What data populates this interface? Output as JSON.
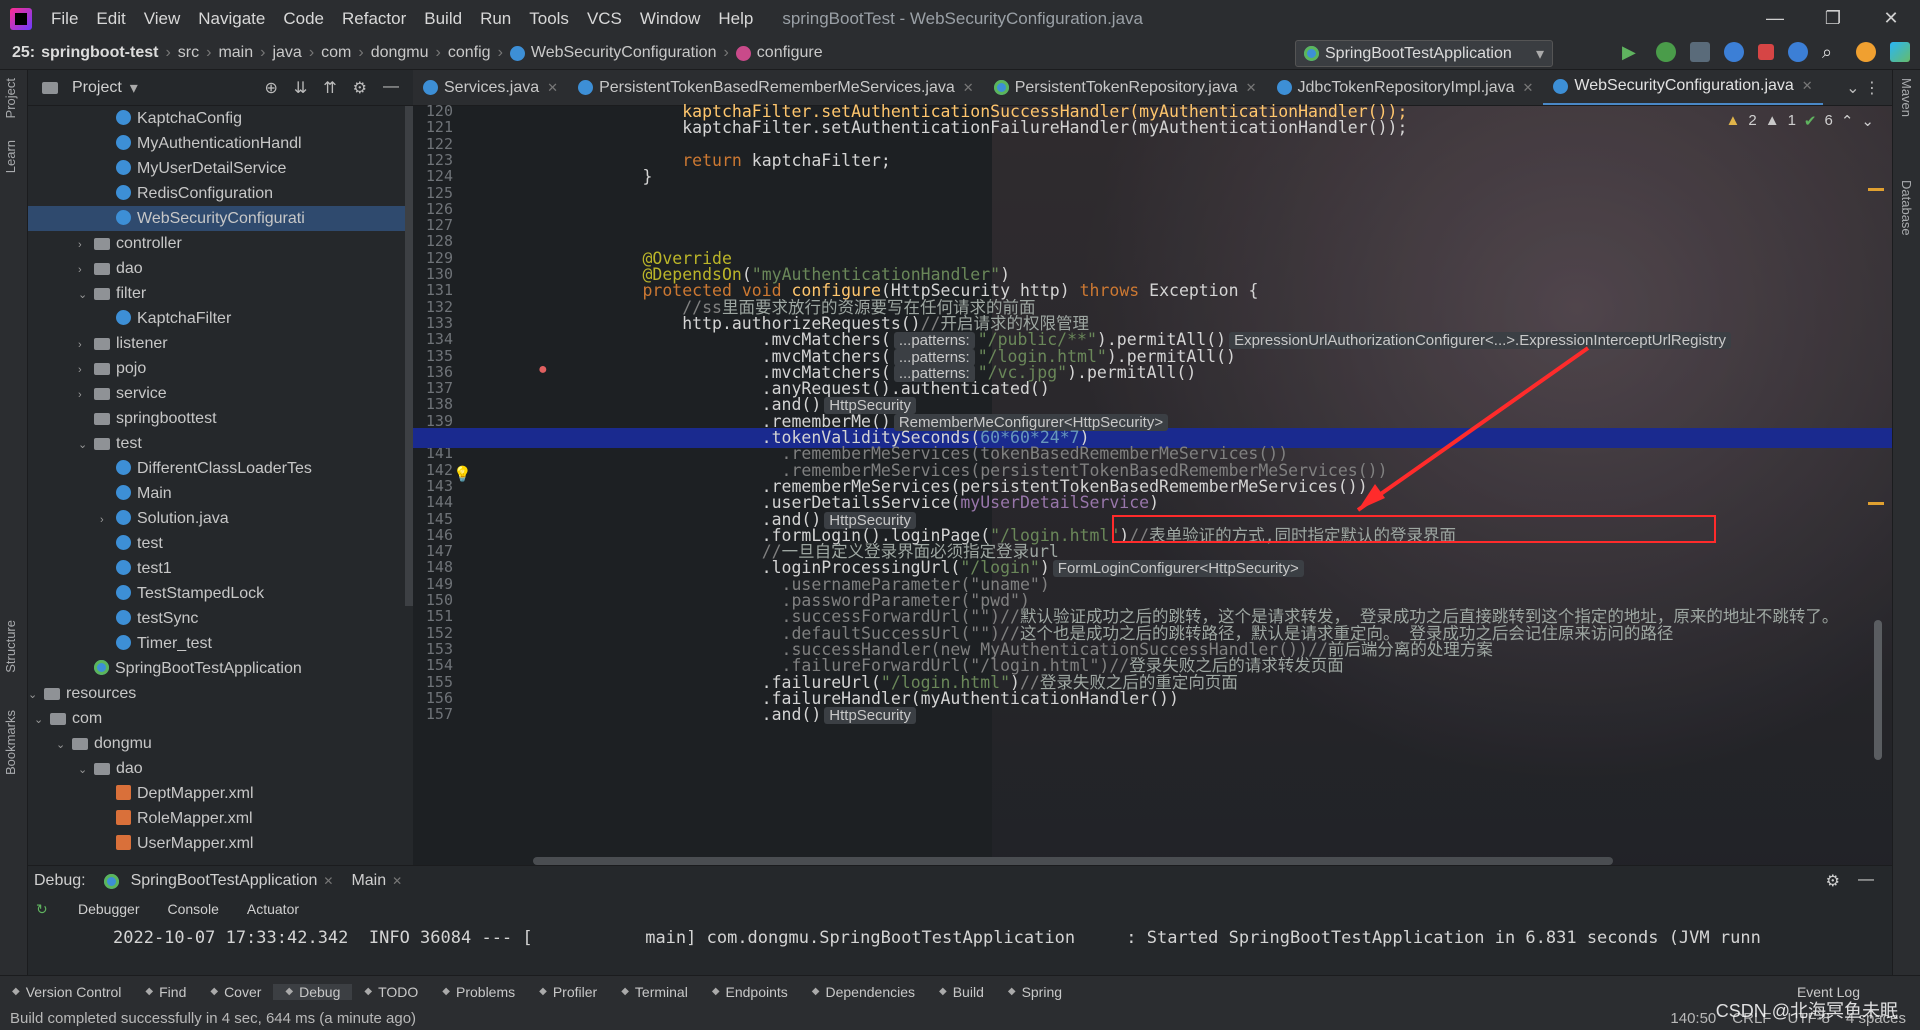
{
  "menubar": {
    "items": [
      "File",
      "Edit",
      "View",
      "Navigate",
      "Code",
      "Refactor",
      "Build",
      "Run",
      "Tools",
      "VCS",
      "Window",
      "Help"
    ],
    "title": "springBootTest - WebSecurityConfiguration.java"
  },
  "nav": {
    "prefix": "25:",
    "project": "springboot-test",
    "crumbs": [
      "src",
      "main",
      "java",
      "com",
      "dongmu",
      "config",
      "WebSecurityConfiguration",
      "configure"
    ],
    "run_config": "SpringBootTestApplication"
  },
  "project_panel": {
    "title": "Project",
    "items": [
      {
        "label": "KaptchaConfig",
        "indent": 6,
        "icon": "c",
        "arrow": ""
      },
      {
        "label": "MyAuthenticationHandl",
        "indent": 6,
        "icon": "c",
        "arrow": ""
      },
      {
        "label": "MyUserDetailService",
        "indent": 6,
        "icon": "c",
        "arrow": ""
      },
      {
        "label": "RedisConfiguration",
        "indent": 6,
        "icon": "c",
        "arrow": ""
      },
      {
        "label": "WebSecurityConfigurati",
        "indent": 6,
        "icon": "c",
        "arrow": "",
        "selected": true
      },
      {
        "label": "controller",
        "indent": 5,
        "icon": "folder",
        "arrow": "›"
      },
      {
        "label": "dao",
        "indent": 5,
        "icon": "folder",
        "arrow": "›"
      },
      {
        "label": "filter",
        "indent": 5,
        "icon": "folder",
        "arrow": "⌄"
      },
      {
        "label": "KaptchaFilter",
        "indent": 6,
        "icon": "c",
        "arrow": ""
      },
      {
        "label": "listener",
        "indent": 5,
        "icon": "folder",
        "arrow": "›"
      },
      {
        "label": "pojo",
        "indent": 5,
        "icon": "folder",
        "arrow": "›"
      },
      {
        "label": "service",
        "indent": 5,
        "icon": "folder",
        "arrow": "›"
      },
      {
        "label": "springboottest",
        "indent": 5,
        "icon": "folder",
        "arrow": ""
      },
      {
        "label": "test",
        "indent": 5,
        "icon": "folder",
        "arrow": "⌄"
      },
      {
        "label": "DifferentClassLoaderTes",
        "indent": 6,
        "icon": "c",
        "arrow": ""
      },
      {
        "label": "Main",
        "indent": 6,
        "icon": "c",
        "arrow": ""
      },
      {
        "label": "Solution.java",
        "indent": 6,
        "icon": "c",
        "arrow": "›"
      },
      {
        "label": "test",
        "indent": 6,
        "icon": "c",
        "arrow": ""
      },
      {
        "label": "test1",
        "indent": 6,
        "icon": "c",
        "arrow": ""
      },
      {
        "label": "TestStampedLock",
        "indent": 6,
        "icon": "c",
        "arrow": ""
      },
      {
        "label": "testSync",
        "indent": 6,
        "icon": "c",
        "arrow": ""
      },
      {
        "label": "Timer_test",
        "indent": 6,
        "icon": "c",
        "arrow": ""
      },
      {
        "label": "SpringBootTestApplication",
        "indent": 5,
        "icon": "sp",
        "arrow": ""
      },
      {
        "label": "resources",
        "indent": 2,
        "icon": "folder",
        "arrow": "⌄"
      },
      {
        "label": "com",
        "indent": 3,
        "icon": "folder",
        "arrow": "⌄"
      },
      {
        "label": "dongmu",
        "indent": 4,
        "icon": "folder",
        "arrow": "⌄"
      },
      {
        "label": "dao",
        "indent": 5,
        "icon": "folder",
        "arrow": "⌄"
      },
      {
        "label": "DeptMapper.xml",
        "indent": 6,
        "icon": "xml",
        "arrow": ""
      },
      {
        "label": "RoleMapper.xml",
        "indent": 6,
        "icon": "xml",
        "arrow": ""
      },
      {
        "label": "UserMapper.xml",
        "indent": 6,
        "icon": "xml",
        "arrow": ""
      }
    ]
  },
  "tabs": [
    {
      "label": "Services.java",
      "active": false
    },
    {
      "label": "PersistentTokenBasedRememberMeServices.java",
      "active": false
    },
    {
      "label": "PersistentTokenRepository.java",
      "active": false
    },
    {
      "label": "JdbcTokenRepositoryImpl.java",
      "active": false
    },
    {
      "label": "WebSecurityConfiguration.java",
      "active": true
    }
  ],
  "inspections": {
    "warnings": "2",
    "weak": "1",
    "ok": "6"
  },
  "lines": [
    {
      "n": "120",
      "h": "            <span class='m'>kaptchaFilter.setAuthenticationSuccessHandler(myAuthenticationHandler());</span>"
    },
    {
      "n": "121",
      "h": "            kaptchaFilter.setAuthenticationFailureHandler(myAuthenticationHandler());"
    },
    {
      "n": "122",
      "h": ""
    },
    {
      "n": "123",
      "h": "            <span class='k'>return</span> kaptchaFilter;"
    },
    {
      "n": "124",
      "h": "        }"
    },
    {
      "n": "125",
      "h": ""
    },
    {
      "n": "126",
      "h": ""
    },
    {
      "n": "127",
      "h": ""
    },
    {
      "n": "128",
      "h": ""
    },
    {
      "n": "129",
      "h": "        <span class='a'>@Override</span>"
    },
    {
      "n": "130",
      "h": "        <span class='a'>@DependsOn</span>(<span class='s'>\"myAuthenticationHandler\"</span>)"
    },
    {
      "n": "131",
      "h": "        <span class='k'>protected void</span> <span class='m'>configure</span>(HttpSecurity http) <span class='k'>throws</span> Exception {"
    },
    {
      "n": "132",
      "h": "            <span class='cm'>//ss</span><span class='zh'>里面要求放行的资源要写在任何请求的前面</span>"
    },
    {
      "n": "133",
      "h": "            http.authorizeRequests()<span class='cm'>//</span><span class='zh'>开启请求的权限管理</span>"
    },
    {
      "n": "134",
      "h": "                    .mvcMatchers(<span class='hint'>...patterns:</span><span class='s'>\"/public/**\"</span>).permitAll()<span class='hint'>ExpressionUrlAuthorizationConfigurer&lt;...&gt;.ExpressionInterceptUrlRegistry</span>"
    },
    {
      "n": "135",
      "h": "                    .mvcMatchers(<span class='hint'>...patterns:</span><span class='s'>\"/login.html\"</span>).permitAll()"
    },
    {
      "n": "136",
      "h": "                    .mvcMatchers(<span class='hint'>...patterns:</span><span class='s'>\"/vc.jpg\"</span>).permitAll()"
    },
    {
      "n": "137",
      "h": "                    .anyRequest().authenticated()"
    },
    {
      "n": "138",
      "h": "                    .and()<span class='hint'>HttpSecurity</span>"
    },
    {
      "n": "139",
      "h": "                    .rememberMe()<span class='hint'>RememberMeConfigurer&lt;HttpSecurity&gt;</span>"
    },
    {
      "n": "140",
      "h": "                    .tokenValiditySeconds(<span class='n'>60*60*24*7</span>)",
      "cur": true
    },
    {
      "n": "141",
      "h": "                      <span class='cm'>.rememberMeServices(tokenBasedRememberMeServices())</span>"
    },
    {
      "n": "142",
      "h": "                      <span class='cm'>.rememberMeServices(persistentTokenBasedRememberMeServices())</span>"
    },
    {
      "n": "143",
      "h": "                    .rememberMeServices(persistentTokenBasedRememberMeServices())"
    },
    {
      "n": "144",
      "h": "                    .userDetailsService(<span class='f'>myUserDetailService</span>)"
    },
    {
      "n": "145",
      "h": "                    .and()<span class='hint'>HttpSecurity</span>"
    },
    {
      "n": "146",
      "h": "                    .formLogin().loginPage(<span class='s'>\"/login.html\"</span>)<span class='cm'>//</span><span class='zh'>表单验证的方式,同时指定默认的登录界面</span>"
    },
    {
      "n": "147",
      "h": "                    <span class='cm'>//</span><span class='zh'>一旦自定义登录界面必须指定登录url</span>"
    },
    {
      "n": "148",
      "h": "                    .loginProcessingUrl(<span class='s'>\"/login\"</span>)<span class='hint'>FormLoginConfigurer&lt;HttpSecurity&gt;</span>"
    },
    {
      "n": "149",
      "h": "                      <span class='cm'>.usernameParameter(\"uname\")</span>"
    },
    {
      "n": "150",
      "h": "                      <span class='cm'>.passwordParameter(\"pwd\")</span>"
    },
    {
      "n": "151",
      "h": "                      <span class='cm'>.successForwardUrl(\"\")//</span><span class='zh'>默认验证成功之后的跳转，这个是请求转发， 登录成功之后直接跳转到这个指定的地址，原来的地址不跳转了。</span>"
    },
    {
      "n": "152",
      "h": "                      <span class='cm'>.defaultSuccessUrl(\"\")//</span><span class='zh'>这个也是成功之后的跳转路径，默认是请求重定向。 登录成功之后会记住原来访问的路径</span>"
    },
    {
      "n": "153",
      "h": "                      <span class='cm'>.successHandler(new MyAuthenticationSuccessHandler())//</span><span class='zh'>前后端分离的处理方案</span>"
    },
    {
      "n": "154",
      "h": "                      <span class='cm'>.failureForwardUrl(\"/login.html\")//</span><span class='zh'>登录失败之后的请求转发页面</span>"
    },
    {
      "n": "155",
      "h": "                    .failureUrl(<span class='s'>\"/login.html\"</span>)<span class='cm'>//</span><span class='zh'>登录失败之后的重定向页面</span>"
    },
    {
      "n": "156",
      "h": "                    .failureHandler(myAuthenticationHandler())"
    },
    {
      "n": "157",
      "h": "                    .and()<span class='hint'>HttpSecurity</span>"
    }
  ],
  "debug": {
    "label": "Debug:",
    "session": "SpringBootTestApplication",
    "tab2": "Main",
    "subtabs": [
      "Debugger",
      "Console",
      "Actuator"
    ],
    "console_line": "2022-10-07 17:33:42.342  INFO 36084 --- [           main] com.dongmu.SpringBootTestApplication     : Started SpringBootTestApplication in 6.831 seconds (JVM runn"
  },
  "toolwindows": [
    "Version Control",
    "Find",
    "Cover",
    "Debug",
    "TODO",
    "Problems",
    "Profiler",
    "Terminal",
    "Endpoints",
    "Dependencies",
    "Build",
    "Spring"
  ],
  "event_log": "Event Log",
  "status": {
    "message": "Build completed successfully in 4 sec, 644 ms (a minute ago)",
    "position": "140:50",
    "line_sep": "CRLF",
    "encoding": "UTF-8",
    "indent": "4 spaces",
    "watermark": "CSDN @北海冥鱼未眠"
  },
  "side_tabs": {
    "left": [
      "Project",
      "Learn",
      "Structure",
      "Bookmarks"
    ],
    "right": [
      "Maven",
      "Database"
    ]
  }
}
